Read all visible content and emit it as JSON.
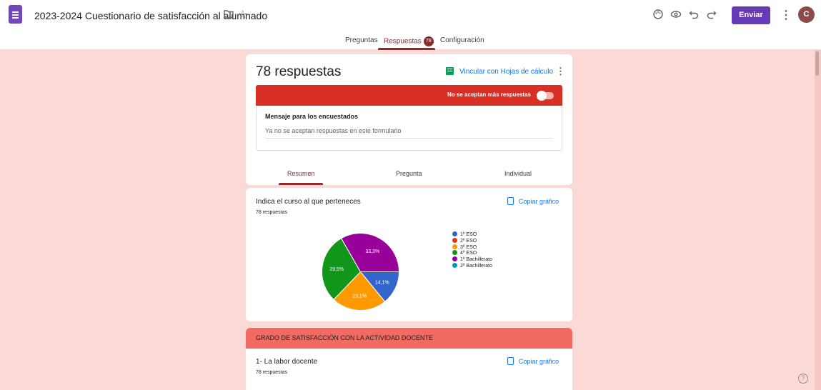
{
  "app": {
    "title": "2023-2024 Cuestionario de satisfacción al alumnado",
    "send_label": "Enviar",
    "avatar_initial": "C",
    "accent_color": "#673ab7"
  },
  "tabs": {
    "questions": "Preguntas",
    "responses": "Respuestas",
    "responses_count": "78",
    "settings": "Configuración"
  },
  "summary": {
    "title": "78 respuestas",
    "sheets_link": "Vincular con Hojas de cálculo",
    "closed_label": "No se aceptan más respuestas",
    "message_heading": "Mensaje para los encuestados",
    "message_value": "Ya no se aceptan respuestas en este formulario",
    "subtabs": [
      "Resumen",
      "Pregunta",
      "Individual"
    ]
  },
  "question1": {
    "title": "Indica el curso al que perteneces",
    "responses": "78 respuestas",
    "copy_label": "Copiar gráfico"
  },
  "section": {
    "title": "GRADO DE SATISFACCIÓN CON LA ACTIVIDAD DOCENTE"
  },
  "question2": {
    "title": "1- La labor docente",
    "responses": "78 respuestas",
    "copy_label": "Copiar gráfico"
  },
  "chart_data": {
    "type": "pie",
    "categories": [
      "1º ESO",
      "2º ESO",
      "3º ESO",
      "4º ESO",
      "1º Bachillerato",
      "2º Bachillerato"
    ],
    "values": [
      14.1,
      0,
      23.1,
      29.5,
      33.3,
      0
    ],
    "labels": [
      "14,1%",
      "",
      "23,1%",
      "29,5%",
      "33,3%",
      ""
    ],
    "colors": [
      "#3366cc",
      "#dc3912",
      "#ff9900",
      "#109618",
      "#990099",
      "#0099c6"
    ],
    "legend_position": "right"
  }
}
